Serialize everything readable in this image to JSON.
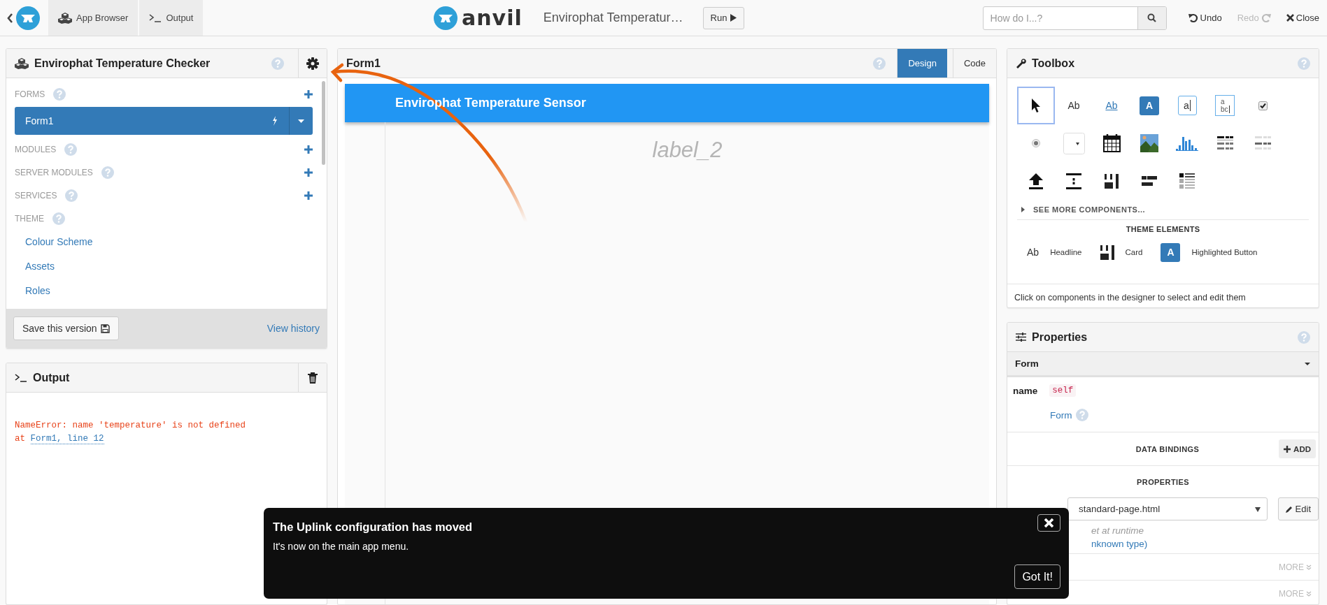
{
  "topbar": {
    "tabs": [
      {
        "label": "App Browser",
        "kind": "apps"
      },
      {
        "label": "Output",
        "kind": "terminal"
      }
    ],
    "logo_text": "anvil",
    "app_title": "Envirophat Temperatur…",
    "run_button": "Run",
    "search": {
      "placeholder": "How do I...?"
    },
    "actions": [
      {
        "label": "Undo",
        "kind": "undo",
        "disabled": false
      },
      {
        "label": "Redo",
        "kind": "redo",
        "disabled": true
      },
      {
        "label": "Close",
        "kind": "close",
        "disabled": false
      }
    ]
  },
  "app_panel": {
    "title": "Envirophat Temperature Checker",
    "sections": [
      {
        "label": "FORMS",
        "addable": true,
        "items": [
          {
            "label": "Form1",
            "selected": true
          }
        ]
      },
      {
        "label": "MODULES",
        "addable": true
      },
      {
        "label": "SERVER MODULES",
        "addable": true
      },
      {
        "label": "SERVICES",
        "addable": true
      },
      {
        "label": "THEME",
        "addable": false,
        "links": [
          "Colour Scheme",
          "Assets",
          "Roles"
        ]
      }
    ],
    "save_button": "Save this version",
    "history_link": "View history"
  },
  "output_panel": {
    "title": "Output",
    "error": "NameError: name 'temperature' is not defined",
    "trace_prefix": "at",
    "trace_link": "Form1, line 12"
  },
  "designer": {
    "title": "Form1",
    "tabs": [
      {
        "label": "Design",
        "selected": true
      },
      {
        "label": "Code",
        "selected": false
      }
    ],
    "header_title": "Envirophat Temperature Sensor",
    "placeholder_label": "label_2"
  },
  "toolbox": {
    "title": "Toolbox",
    "tools": [
      {
        "kind": "pointer",
        "selected": true
      },
      {
        "kind": "label",
        "glyph": "Ab",
        "selected": false
      },
      {
        "kind": "link",
        "glyph": "Ab",
        "selected": false
      },
      {
        "kind": "button",
        "glyph": "A",
        "selected": false
      },
      {
        "kind": "textbox",
        "glyph": "a",
        "selected": false
      },
      {
        "kind": "textarea",
        "glyph": "a",
        "glyph_2": "bc",
        "selected": false
      },
      {
        "kind": "checkbox",
        "selected": false
      },
      {
        "kind": "radio",
        "selected": false
      },
      {
        "kind": "dropdown",
        "selected": false
      },
      {
        "kind": "calendar",
        "selected": false
      },
      {
        "kind": "image",
        "selected": false
      },
      {
        "kind": "plot",
        "selected": false
      },
      {
        "kind": "grid",
        "selected": false
      },
      {
        "kind": "repeating",
        "selected": false
      },
      {
        "kind": "upload",
        "selected": false
      },
      {
        "kind": "spacer",
        "selected": false
      },
      {
        "kind": "card",
        "selected": false
      },
      {
        "kind": "flow",
        "selected": false
      },
      {
        "kind": "list",
        "selected": false
      }
    ],
    "see_more": "SEE MORE COMPONENTS...",
    "theme_title": "THEME ELEMENTS",
    "theme_elements": [
      {
        "kind": "label",
        "glyph": "Ab",
        "label": "Headline"
      },
      {
        "kind": "card",
        "label": "Card"
      },
      {
        "kind": "button",
        "glyph": "A",
        "label": "Highlighted Button"
      }
    ],
    "hint": "Click on components in the designer to select and edit them"
  },
  "properties": {
    "title": "Properties",
    "component": "Form",
    "name_label": "name",
    "name_value": "self",
    "type_link": "Form",
    "bindings_title": "DATA BINDINGS",
    "add_button": "ADD",
    "section_title": "PROPERTIES",
    "html_value": "standard-page.html",
    "edit_button": "Edit",
    "note": "et at runtime",
    "type_note": "nknown type)",
    "more_rows": [
      "MORE",
      "MORE"
    ]
  },
  "notice": {
    "title": "The Uplink configuration has moved",
    "message": "It's now on the main app menu.",
    "button": "Got It!"
  }
}
